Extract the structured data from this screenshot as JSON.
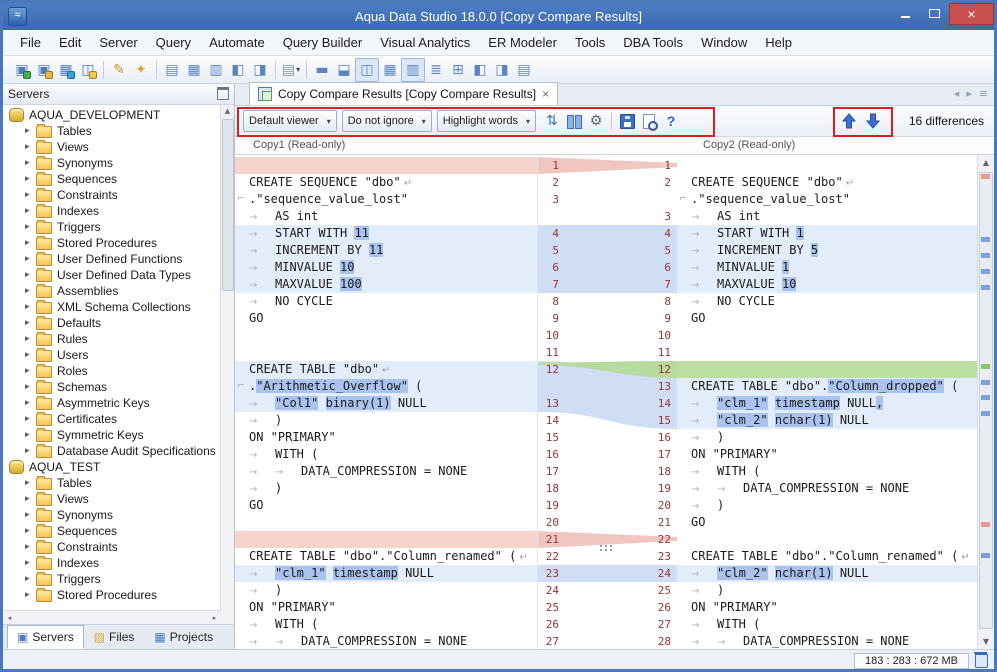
{
  "window": {
    "title": "Aqua Data Studio 18.0.0 [Copy Compare Results]"
  },
  "menu": {
    "items": [
      "File",
      "Edit",
      "Server",
      "Query",
      "Automate",
      "Query Builder",
      "Visual Analytics",
      "ER Modeler",
      "Tools",
      "DBA Tools",
      "Window",
      "Help"
    ]
  },
  "toolbar": {
    "groups": [
      [
        {
          "name": "register-server-icon",
          "glyph": "▣",
          "color": "#4e7bbf",
          "badge": "#44b04a"
        },
        {
          "name": "server-folder-icon",
          "glyph": "▣",
          "color": "#4e7bbf",
          "badge": "#e8bb3e"
        },
        {
          "name": "schema-browser-icon",
          "glyph": "▦",
          "color": "#4e7bbf",
          "badge": "#36a3d9"
        },
        {
          "name": "server-windows-icon",
          "glyph": "◫",
          "color": "#4e7bbf",
          "badge": "#f2c84b"
        }
      ],
      [
        {
          "name": "query-window-icon",
          "glyph": "✎",
          "color": "#c8992f"
        },
        {
          "name": "automate-icon",
          "glyph": "✦",
          "color": "#d8a531"
        }
      ],
      [
        {
          "name": "query-analyzer-icon",
          "glyph": "▤",
          "color": "#5b84c4"
        },
        {
          "name": "results-grid-icon",
          "glyph": "▦",
          "color": "#5b84c4"
        },
        {
          "name": "results-text-icon",
          "glyph": "▥",
          "color": "#5b84c4"
        },
        {
          "name": "window-tile-icon",
          "glyph": "◧",
          "color": "#5b84c4"
        },
        {
          "name": "window-cascade-icon",
          "glyph": "◨",
          "color": "#5b84c4"
        }
      ],
      [
        {
          "name": "new-file-icon",
          "glyph": "▤",
          "color": "#8a94a4",
          "caret": true
        }
      ],
      [
        {
          "name": "layout-single-icon",
          "glyph": "▬",
          "color": "#5b84c4"
        },
        {
          "name": "layout-rows-icon",
          "glyph": "⬓",
          "color": "#5b84c4"
        },
        {
          "name": "layout-columns-icon",
          "glyph": "◫",
          "color": "#5b84c4",
          "active": true
        },
        {
          "name": "grid-view-icon",
          "glyph": "▦",
          "color": "#5b84c4"
        },
        {
          "name": "column-headers-icon",
          "glyph": "▥",
          "color": "#5b84c4",
          "active": true
        },
        {
          "name": "row-numbers-icon",
          "glyph": "≣",
          "color": "#5b84c4"
        },
        {
          "name": "cell-grid-icon",
          "glyph": "⊞",
          "color": "#5b84c4"
        },
        {
          "name": "split-left-icon",
          "glyph": "◧",
          "color": "#5b84c4"
        },
        {
          "name": "split-right-icon",
          "glyph": "◨",
          "color": "#5b84c4"
        },
        {
          "name": "list-view-icon",
          "glyph": "▤",
          "color": "#5b84c4"
        }
      ]
    ]
  },
  "sidebar": {
    "title": "Servers",
    "tree": [
      {
        "label": "AQUA_DEVELOPMENT",
        "type": "database"
      },
      {
        "label": "Tables",
        "type": "folder"
      },
      {
        "label": "Views",
        "type": "folder"
      },
      {
        "label": "Synonyms",
        "type": "folder"
      },
      {
        "label": "Sequences",
        "type": "folder"
      },
      {
        "label": "Constraints",
        "type": "folder"
      },
      {
        "label": "Indexes",
        "type": "folder"
      },
      {
        "label": "Triggers",
        "type": "folder"
      },
      {
        "label": "Stored Procedures",
        "type": "folder"
      },
      {
        "label": "User Defined Functions",
        "type": "folder"
      },
      {
        "label": "User Defined Data Types",
        "type": "folder"
      },
      {
        "label": "Assemblies",
        "type": "folder"
      },
      {
        "label": "XML Schema Collections",
        "type": "folder"
      },
      {
        "label": "Defaults",
        "type": "folder"
      },
      {
        "label": "Rules",
        "type": "folder"
      },
      {
        "label": "Users",
        "type": "folder"
      },
      {
        "label": "Roles",
        "type": "folder"
      },
      {
        "label": "Schemas",
        "type": "folder"
      },
      {
        "label": "Asymmetric Keys",
        "type": "folder"
      },
      {
        "label": "Certificates",
        "type": "folder"
      },
      {
        "label": "Symmetric Keys",
        "type": "folder"
      },
      {
        "label": "Database Audit Specifications",
        "type": "folder"
      },
      {
        "label": "AQUA_TEST",
        "type": "database"
      },
      {
        "label": "Tables",
        "type": "folder"
      },
      {
        "label": "Views",
        "type": "folder"
      },
      {
        "label": "Synonyms",
        "type": "folder"
      },
      {
        "label": "Sequences",
        "type": "folder"
      },
      {
        "label": "Constraints",
        "type": "folder"
      },
      {
        "label": "Indexes",
        "type": "folder"
      },
      {
        "label": "Triggers",
        "type": "folder"
      },
      {
        "label": "Stored Procedures",
        "type": "folder"
      }
    ],
    "tabs": [
      {
        "label": "Servers",
        "glyph": "▣",
        "color": "#4a79c4",
        "active": true
      },
      {
        "label": "Files",
        "glyph": "▨",
        "color": "#d8a93a",
        "active": false
      },
      {
        "label": "Projects",
        "glyph": "▦",
        "color": "#4a79c4",
        "active": false
      }
    ]
  },
  "main": {
    "tab_label": "Copy Compare Results [Copy Compare Results]",
    "tab_close": "×",
    "compare_toolbar": {
      "viewer": "Default viewer",
      "ignore": "Do not ignore",
      "highlight": "Highlight words",
      "differences": "16 differences",
      "icons": [
        {
          "name": "sync-scrolling-icon",
          "cls": "ic-sync",
          "glyph": "⇅"
        },
        {
          "name": "side-by-side-layout-icon",
          "cls": "ic-cols"
        },
        {
          "name": "compare-settings-gear-icon",
          "cls": "ic-gear",
          "glyph": "⚙",
          "sep_after": true
        },
        {
          "name": "save-results-icon",
          "cls": "ic-save"
        },
        {
          "name": "print-preview-icon",
          "cls": "ic-preview"
        },
        {
          "name": "help-icon",
          "cls": "ic-help",
          "glyph": "?"
        }
      ]
    },
    "left_header": "Copy1 (Read-only)",
    "right_header": "Copy2 (Read-only)",
    "rows": [
      {
        "n": [
          "1",
          "1"
        ],
        "l": {
          "bg": "del",
          "segs": []
        },
        "r": {
          "segs": []
        }
      },
      {
        "n": [
          "2",
          "2"
        ],
        "l": {
          "segs": [
            "CREATE SEQUENCE \"dbo\""
          ],
          "wrap": 1
        },
        "r": {
          "segs": [
            "CREATE SEQUENCE \"dbo\""
          ],
          "wrap": 1
        }
      },
      {
        "n": [
          "3",
          ""
        ],
        "l": {
          "cont": 1,
          "segs": [
            ".\"sequence_value_lost\""
          ]
        },
        "r": {
          "cont": 1,
          "segs": [
            ".\"sequence_value_lost\""
          ]
        }
      },
      {
        "n": [
          "",
          "3"
        ],
        "l": {
          "ind": 1,
          "segs": [
            "AS int"
          ]
        },
        "r": {
          "ind": 1,
          "segs": [
            "AS int"
          ]
        }
      },
      {
        "n": [
          "4",
          "4"
        ],
        "l": {
          "bg": "chg",
          "ind": 1,
          "segs": [
            "START WITH ",
            [
              "11"
            ]
          ]
        },
        "r": {
          "bg": "chg",
          "ind": 1,
          "segs": [
            "START WITH ",
            [
              "1"
            ]
          ]
        }
      },
      {
        "n": [
          "5",
          "5"
        ],
        "l": {
          "bg": "chg",
          "ind": 1,
          "segs": [
            "INCREMENT BY ",
            [
              "11"
            ]
          ]
        },
        "r": {
          "bg": "chg",
          "ind": 1,
          "segs": [
            "INCREMENT BY ",
            [
              "5"
            ]
          ]
        }
      },
      {
        "n": [
          "6",
          "6"
        ],
        "l": {
          "bg": "chg",
          "ind": 1,
          "segs": [
            "MINVALUE ",
            [
              "10"
            ]
          ]
        },
        "r": {
          "bg": "chg",
          "ind": 1,
          "segs": [
            "MINVALUE ",
            [
              "1"
            ]
          ]
        }
      },
      {
        "n": [
          "7",
          "7"
        ],
        "l": {
          "bg": "chg",
          "ind": 1,
          "segs": [
            "MAXVALUE ",
            [
              "100"
            ]
          ]
        },
        "r": {
          "bg": "chg",
          "ind": 1,
          "segs": [
            "MAXVALUE ",
            [
              "10"
            ]
          ]
        }
      },
      {
        "n": [
          "8",
          "8"
        ],
        "l": {
          "ind": 1,
          "segs": [
            "NO CYCLE"
          ]
        },
        "r": {
          "ind": 1,
          "segs": [
            "NO CYCLE"
          ]
        }
      },
      {
        "n": [
          "9",
          "9"
        ],
        "l": {
          "segs": [
            "GO"
          ]
        },
        "r": {
          "segs": [
            "GO"
          ]
        }
      },
      {
        "n": [
          "10",
          "10"
        ],
        "l": {
          "segs": []
        },
        "r": {
          "segs": []
        }
      },
      {
        "n": [
          "11",
          "11"
        ],
        "l": {
          "segs": []
        },
        "r": {
          "segs": []
        }
      },
      {
        "n": [
          "12",
          "12"
        ],
        "l": {
          "bg": "chg",
          "segs": [
            "CREATE TABLE \"dbo\""
          ],
          "wrap": 1
        },
        "r": {
          "bg": "add",
          "segs": []
        }
      },
      {
        "n": [
          "",
          "13"
        ],
        "l": {
          "bg": "chg",
          "cont": 1,
          "segs": [
            ".",
            [
              "\"Arithmetic_Overflow\""
            ],
            " ("
          ]
        },
        "r": {
          "bg": "chg",
          "segs": [
            "CREATE TABLE \"dbo\".",
            [
              "\"Column_dropped\""
            ],
            " ("
          ]
        }
      },
      {
        "n": [
          "13",
          "14"
        ],
        "l": {
          "bg": "chg",
          "ind": 1,
          "segs": [
            [
              "\"Col1\""
            ],
            " ",
            [
              "binary(1)"
            ],
            " NULL"
          ]
        },
        "r": {
          "bg": "chg",
          "ind": 1,
          "segs": [
            [
              "\"clm_1\""
            ],
            " ",
            [
              "timestamp"
            ],
            " NULL",
            [
              ","
            ]
          ]
        }
      },
      {
        "n": [
          "14",
          "15"
        ],
        "l": {
          "ind": 1,
          "segs": [
            ")"
          ]
        },
        "r": {
          "bg": "chg",
          "ind": 1,
          "segs": [
            [
              "\"clm_2\""
            ],
            " ",
            [
              "nchar(1)"
            ],
            " NULL"
          ]
        }
      },
      {
        "n": [
          "15",
          "16"
        ],
        "l": {
          "segs": [
            "ON \"PRIMARY\""
          ]
        },
        "r": {
          "ind": 1,
          "segs": [
            ")"
          ]
        }
      },
      {
        "n": [
          "16",
          "17"
        ],
        "l": {
          "ind": 1,
          "segs": [
            "WITH ("
          ]
        },
        "r": {
          "segs": [
            "ON \"PRIMARY\""
          ]
        }
      },
      {
        "n": [
          "17",
          "18"
        ],
        "l": {
          "ind": 2,
          "segs": [
            "DATA_COMPRESSION = NONE"
          ]
        },
        "r": {
          "ind": 1,
          "segs": [
            "WITH ("
          ]
        }
      },
      {
        "n": [
          "18",
          "19"
        ],
        "l": {
          "ind": 1,
          "segs": [
            ")"
          ]
        },
        "r": {
          "ind": 2,
          "segs": [
            "DATA_COMPRESSION = NONE"
          ]
        }
      },
      {
        "n": [
          "19",
          "20"
        ],
        "l": {
          "segs": [
            "GO"
          ]
        },
        "r": {
          "ind": 1,
          "segs": [
            ")"
          ]
        }
      },
      {
        "n": [
          "20",
          "21"
        ],
        "l": {
          "segs": []
        },
        "r": {
          "segs": [
            "GO"
          ]
        }
      },
      {
        "n": [
          "21",
          "22"
        ],
        "l": {
          "bg": "del",
          "segs": []
        },
        "r": {
          "segs": []
        }
      },
      {
        "n": [
          "22",
          "23"
        ],
        "l": {
          "segs": [
            "CREATE TABLE \"dbo\".\"Column_renamed\" ("
          ],
          "wrap": 1
        },
        "r": {
          "segs": [
            "CREATE TABLE \"dbo\".\"Column_renamed\" ("
          ],
          "wrap": 1
        }
      },
      {
        "n": [
          "23",
          "24"
        ],
        "l": {
          "bg": "chg",
          "ind": 1,
          "segs": [
            [
              "\"clm_1\""
            ],
            " ",
            [
              "timestamp"
            ],
            " NULL"
          ]
        },
        "r": {
          "bg": "chg",
          "ind": 1,
          "segs": [
            [
              "\"clm_2\""
            ],
            " ",
            [
              "nchar(1)"
            ],
            " NULL"
          ]
        }
      },
      {
        "n": [
          "24",
          "25"
        ],
        "l": {
          "ind": 1,
          "segs": [
            ")"
          ]
        },
        "r": {
          "ind": 1,
          "segs": [
            ")"
          ]
        }
      },
      {
        "n": [
          "25",
          "26"
        ],
        "l": {
          "segs": [
            "ON \"PRIMARY\""
          ]
        },
        "r": {
          "segs": [
            "ON \"PRIMARY\""
          ]
        }
      },
      {
        "n": [
          "26",
          "27"
        ],
        "l": {
          "ind": 1,
          "segs": [
            "WITH ("
          ]
        },
        "r": {
          "ind": 1,
          "segs": [
            "WITH ("
          ]
        }
      },
      {
        "n": [
          "27",
          "28"
        ],
        "l": {
          "ind": 2,
          "segs": [
            "DATA_COMPRESSION = NONE"
          ]
        },
        "r": {
          "ind": 2,
          "segs": [
            "DATA_COMPRESSION = NONE"
          ]
        }
      }
    ],
    "colors": {
      "changed_row": "#e3ecf9",
      "changed_word": "#a9c2ee",
      "added_row": "#bcdfa2",
      "deleted_row": "#f6d3cb",
      "line_number": "#993333"
    }
  },
  "statusbar": {
    "memory": "183 : 283 : 672 MB"
  }
}
